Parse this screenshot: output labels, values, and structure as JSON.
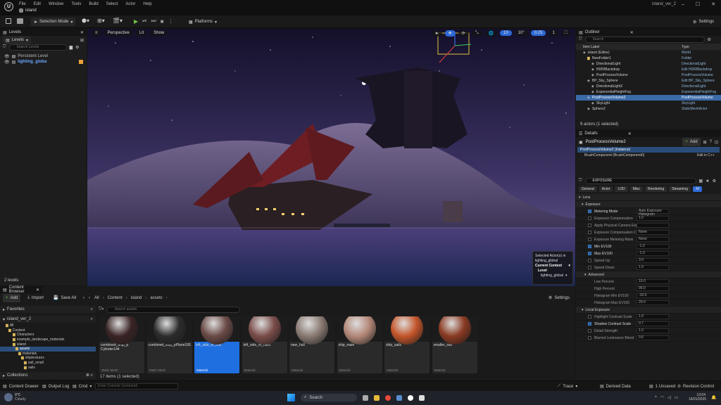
{
  "app": {
    "project_tab": "island",
    "project_name": "island_ver_2"
  },
  "menu": [
    "File",
    "Edit",
    "Window",
    "Tools",
    "Build",
    "Select",
    "Actor",
    "Help"
  ],
  "toolbar": {
    "selection_mode": "Selection Mode",
    "platforms": "Platforms",
    "settings": "Settings"
  },
  "levels": {
    "tab": "Levels",
    "dropdown": "Levels",
    "search_placeholder": "Search Levels",
    "items": [
      "Persistent Level",
      "lighting_globa"
    ],
    "footer": "2 levels"
  },
  "viewport": {
    "perspective": "Perspective",
    "lit": "Lit",
    "show": "Show",
    "grid": "10",
    "angle": "10°",
    "scale": "0.25",
    "speed": "1",
    "selection_info": {
      "line1": "Selected Actor(s) in",
      "line2": "lighting_global",
      "current_context": "Current Context",
      "level_label": "Level",
      "level_value": "lighting_global"
    }
  },
  "outliner": {
    "tab": "Outliner",
    "search_placeholder": "Search",
    "col_label": "Item Label",
    "col_type": "Type",
    "rows": [
      {
        "label": "island (Editor)",
        "type": "World"
      },
      {
        "label": "NewFolder1",
        "type": "Folder"
      },
      {
        "label": "DirectionalLight",
        "type": "DirectionalLight"
      },
      {
        "label": "HDRIBackdrop",
        "type": "Edit HDRIBackdrop"
      },
      {
        "label": "PostProcessVolume",
        "type": "PostProcessVolume"
      },
      {
        "label": "BP_Sky_Sphere",
        "type": "Edit BP_Sky_Sphere"
      },
      {
        "label": "DirectionalLight2",
        "type": "DirectionalLight"
      },
      {
        "label": "ExponentialHeightFog",
        "type": "ExponentialHeightFog"
      },
      {
        "label": "PostProcessVolume2",
        "type": "PostProcessVolume"
      },
      {
        "label": "SkyLight",
        "type": "SkyLight"
      },
      {
        "label": "Sphere2",
        "type": "StaticMeshActor"
      }
    ],
    "footer": "9 actors (1 selected)"
  },
  "details": {
    "tab": "Details",
    "object": "PostProcessVolume2",
    "add": "Add",
    "instance": "PostProcessVolume2 (Instance)",
    "component": "BrushComponent (BrushComponent0)",
    "component_action": "Edit in C++",
    "search_value": "EXPOSURE",
    "filters": [
      "General",
      "Actor",
      "LOD",
      "Misc",
      "Rendering",
      "Streaming",
      "All"
    ],
    "section_lens": "Lens",
    "section_exposure": "Exposure",
    "props": [
      {
        "label": "Metering Mode",
        "value": "Auto Exposure Histogram",
        "on": true
      },
      {
        "label": "Exposure Compensation",
        "value": "1.0",
        "on": false
      },
      {
        "label": "Apply Physical Camera Exp",
        "value": "",
        "on": false
      },
      {
        "label": "Exposure Compensation C",
        "value": "None",
        "on": false
      },
      {
        "label": "Exposure Metering Mask",
        "value": "None",
        "on": false
      },
      {
        "label": "Min EV100",
        "value": "-1.0",
        "on": true
      },
      {
        "label": "Max EV100",
        "value": "-1.0",
        "on": true
      },
      {
        "label": "Speed Up",
        "value": "3.0",
        "on": false
      },
      {
        "label": "Speed Down",
        "value": "1.0",
        "on": false
      }
    ],
    "section_advanced": "Advanced",
    "adv": [
      {
        "label": "Low Percent",
        "value": "10.0"
      },
      {
        "label": "High Percent",
        "value": "90.0"
      },
      {
        "label": "Histogram Min EV100",
        "value": "-10.0"
      },
      {
        "label": "Histogram Max EV100",
        "value": "20.0"
      }
    ],
    "section_local": "Local Exposure",
    "local": [
      {
        "label": "Highlight Contrast Scale",
        "value": "1.0",
        "on": false
      },
      {
        "label": "Shadow Contrast Scale",
        "value": "0.7",
        "on": true
      },
      {
        "label": "Detail Strength",
        "value": "1.0",
        "on": false
      },
      {
        "label": "Blurred Luminance Blend",
        "value": "0.6",
        "on": false
      }
    ]
  },
  "content_browser": {
    "tab": "Content Browser",
    "add": "Add",
    "import": "Import",
    "save_all": "Save All",
    "settings": "Settings",
    "path": [
      "All",
      "Content",
      "island",
      "assets"
    ],
    "search_placeholder": "Search assets",
    "tree": [
      "All",
      "Content",
      "Characters",
      "example_landscape_materials",
      "island",
      "assets",
      "materials",
      "shiptextures",
      "sail_small",
      "sails"
    ],
    "favorites": "Favorites",
    "project": "island_ver_2",
    "collections": "Collections",
    "footer": "17 items (1 selected)",
    "assets": [
      {
        "name": "combined_ship_p Cylinder144",
        "type": "Static Mesh"
      },
      {
        "name": "combined_ship_pPlane195",
        "type": "Static Mesh"
      },
      {
        "name": "left_side_of_hull",
        "type": "Material"
      },
      {
        "name": "left_side_of_hull1",
        "type": "Material"
      },
      {
        "name": "new_hull",
        "type": "Material"
      },
      {
        "name": "ship_main",
        "type": "Material"
      },
      {
        "name": "ship_sails",
        "type": "Material"
      },
      {
        "name": "smaller_sail",
        "type": "Material"
      }
    ]
  },
  "status": {
    "content_drawer": "Content Drawer",
    "output_log": "Output Log",
    "cmd": "Cmd",
    "console_placeholder": "Enter Console Command",
    "trace": "Trace",
    "derived_data": "Derived Data",
    "unsaved": "1 Unsaved",
    "revision_control": "Revision Control"
  },
  "taskbar": {
    "temp": "9°C",
    "weather": "Cloudy",
    "search": "Search",
    "time": "13:04",
    "date": "16/01/2025"
  }
}
